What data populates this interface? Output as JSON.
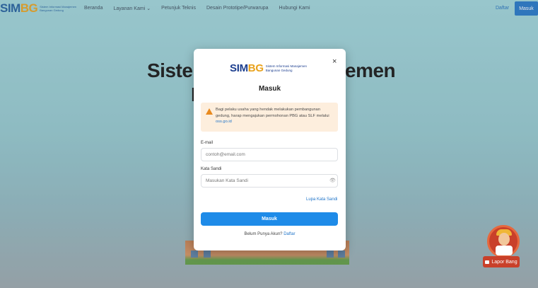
{
  "header": {
    "logo_text": "SIM",
    "logo_text_accent": "BG",
    "logo_subtitle": "Sistem Informasi Manajemen Bangunan Gedung",
    "nav": [
      "Beranda",
      "Layanan Kami",
      "Petunjuk Teknis",
      "Desain Prototipe/Purwarupa",
      "Hubungi Kami"
    ],
    "daftar_label": "Daftar",
    "masuk_label": "Masuk"
  },
  "hero": {
    "title_left": "Sister",
    "title_right": "emen",
    "title_line2": "I"
  },
  "modal": {
    "logo_text": "SIM",
    "logo_text_accent": "BG",
    "logo_subtitle": "Sistem Informasi Manajemen Bangunan Gedung",
    "close_symbol": "×",
    "title": "Masuk",
    "alert": {
      "text": "Bagi pelaku usaha yang hendak melakukan pembangunan gedung, harap mengajukan permohonan PBG atau SLF melalui",
      "link": "oss.go.id"
    },
    "email": {
      "label": "E-mail",
      "placeholder": "contoh@email.com"
    },
    "password": {
      "label": "Kata Sandi",
      "placeholder": "Masukan Kata Sandi"
    },
    "forgot_label": "Lupa Kata Sandi",
    "submit_label": "Masuk",
    "footer_text": "Belum Punya Akun?",
    "footer_link": "Daftar"
  },
  "floating": {
    "lapor_label": "Lapor Bang"
  },
  "colors": {
    "primary": "#1e8be8",
    "brand_blue": "#1d3f8f",
    "brand_yellow": "#e9a21c",
    "alert_bg": "#fdeedd",
    "alert_icon": "#e98a1f",
    "lapor_red": "#c9402a"
  }
}
